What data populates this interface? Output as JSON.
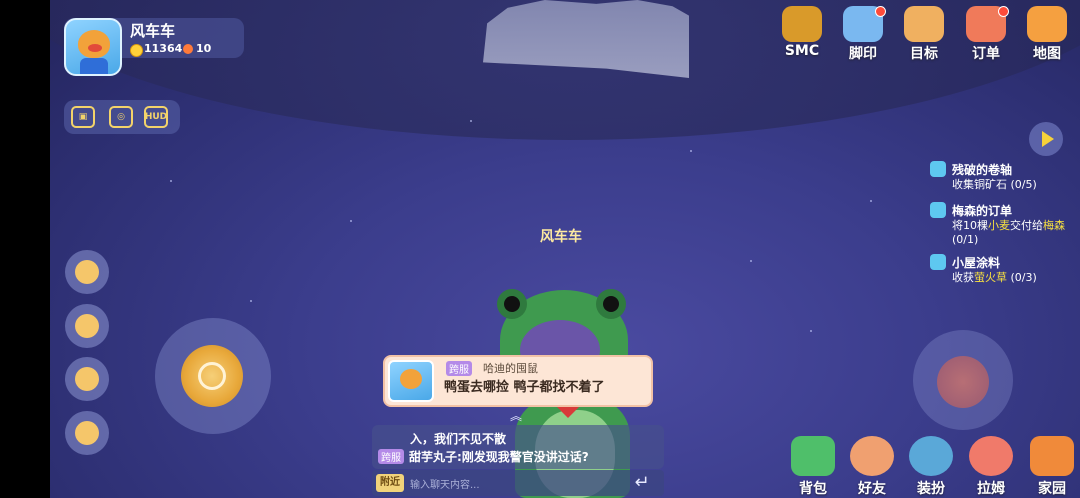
{
  "player": {
    "name": "风车车",
    "coins": "11364",
    "gems": "10"
  },
  "tools": [
    "",
    "",
    "HUD"
  ],
  "top_menu": [
    {
      "key": "smc",
      "label": "SMC",
      "icon": "smc-badge-icon",
      "color": "#d99a2a"
    },
    {
      "key": "footprint",
      "label": "脚印",
      "icon": "footprint-icon",
      "color": "#7ab8f0"
    },
    {
      "key": "goal",
      "label": "目标",
      "icon": "goal-book-icon",
      "color": "#f0b060"
    },
    {
      "key": "order",
      "label": "订单",
      "icon": "order-clipboard-icon",
      "color": "#f07a5a"
    },
    {
      "key": "map",
      "label": "地图",
      "icon": "castle-map-icon",
      "color": "#f5a040"
    }
  ],
  "quests": [
    {
      "title": "残破的卷轴",
      "desc_pre": "收集铜矿石 (0/5)",
      "hl": "",
      "desc_post": ""
    },
    {
      "title": "梅森的订单",
      "desc_pre": "将10棵",
      "hl": "小麦",
      "desc_mid": "交付给",
      "hl2": "梅森",
      "desc_post": " (0/1)"
    },
    {
      "title": "小屋涂料",
      "desc_pre": "收获",
      "hl": "萤火草",
      "desc_post": " (0/3)"
    }
  ],
  "character": {
    "name": "风车车"
  },
  "bubble": {
    "tag": "跨服",
    "name": "哈迪的囤鼠",
    "message": "鸭蛋去哪捡   鸭子都找不着了"
  },
  "chat": {
    "line1": "入，我们不见不散",
    "line2_tag": "跨服",
    "line2": "甜芋丸子:刚发现我警官没讲过话?",
    "channel": "附近",
    "placeholder": "输入聊天内容..."
  },
  "bottom_menu": [
    {
      "key": "bag",
      "label": "背包",
      "icon": "backpack-icon",
      "color": "#4fbf6a"
    },
    {
      "key": "friends",
      "label": "好友",
      "icon": "friends-icon",
      "color": "#f0a070"
    },
    {
      "key": "dressup",
      "label": "装扮",
      "icon": "dressup-icon",
      "color": "#5aa8d8"
    },
    {
      "key": "lamu",
      "label": "拉姆",
      "icon": "lamu-pet-icon",
      "color": "#f07a6a"
    },
    {
      "key": "home",
      "label": "家园",
      "icon": "home-icon",
      "color": "#f08a3a"
    }
  ]
}
